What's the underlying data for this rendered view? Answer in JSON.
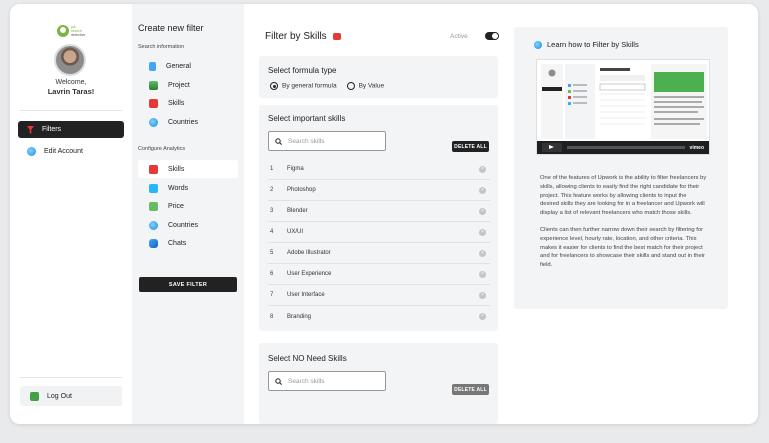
{
  "sidebar": {
    "logo_text": "job search detective",
    "welcome": "Welcome,",
    "user_name": "Lavrin Taras!",
    "nav": [
      {
        "label": "Filters",
        "icon": "filter-icon",
        "active": true
      },
      {
        "label": "Edit Account",
        "icon": "globe-icon",
        "active": false
      }
    ],
    "logout_label": "Log Out"
  },
  "menu": {
    "title": "Create new filter",
    "search_info_label": "Search information",
    "search_info_items": [
      {
        "label": "General",
        "icon": "document-icon"
      },
      {
        "label": "Project",
        "icon": "stack-icon"
      },
      {
        "label": "Skills",
        "icon": "briefcase-icon"
      },
      {
        "label": "Countries",
        "icon": "globe-icon"
      }
    ],
    "analytics_label": "Configure Analytics",
    "analytics_items": [
      {
        "label": "Skills",
        "icon": "briefcase-icon",
        "active": true
      },
      {
        "label": "Words",
        "icon": "chat-icon"
      },
      {
        "label": "Price",
        "icon": "money-icon"
      },
      {
        "label": "Countries",
        "icon": "globe-icon"
      },
      {
        "label": "Chats",
        "icon": "chats-icon"
      }
    ],
    "save_label": "SAVE FILTER"
  },
  "main": {
    "title": "Filter by Skills",
    "active_label": "Active",
    "formula_title": "Select formula type",
    "formula_options": [
      "By general formula",
      "By Value"
    ],
    "formula_selected": 0,
    "important_title": "Select important skills",
    "search_placeholder": "Search skills",
    "delete_all": "DELETE ALL",
    "skills": [
      {
        "num": "1",
        "name": "Figma"
      },
      {
        "num": "2",
        "name": "Photoshop"
      },
      {
        "num": "3",
        "name": "Blender"
      },
      {
        "num": "4",
        "name": "UX/UI"
      },
      {
        "num": "5",
        "name": "Adobe Illustrator"
      },
      {
        "num": "6",
        "name": "User Experience"
      },
      {
        "num": "7",
        "name": "User Interface"
      },
      {
        "num": "8",
        "name": "Branding"
      }
    ],
    "no_need_title": "Select NO Need Skills",
    "no_need_placeholder": "Search skills",
    "no_need_delete_all": "DELETE ALL"
  },
  "learn": {
    "title": "Learn how to Filter by Skills",
    "video_brand": "vimeo",
    "paragraph1": "One of the features of Upwork is the ability to filter freelancers by skills, allowing clients to easily find the right candidate for their project. This feature works by allowing clients to input the desired skills they are looking for in a freelancer and Upwork will display a list of relevant freelancers who match those skills.",
    "paragraph2": "Clients can then further narrow down their search by filtering for experience level, hourly rate, location, and other criteria. This makes it easier for clients to find the best match for their project and for freelancers to showcase their skills and stand out in their field."
  },
  "colors": {
    "accent": "#222222",
    "panel": "#f3f4f5",
    "filter_icon": "#e53935"
  }
}
